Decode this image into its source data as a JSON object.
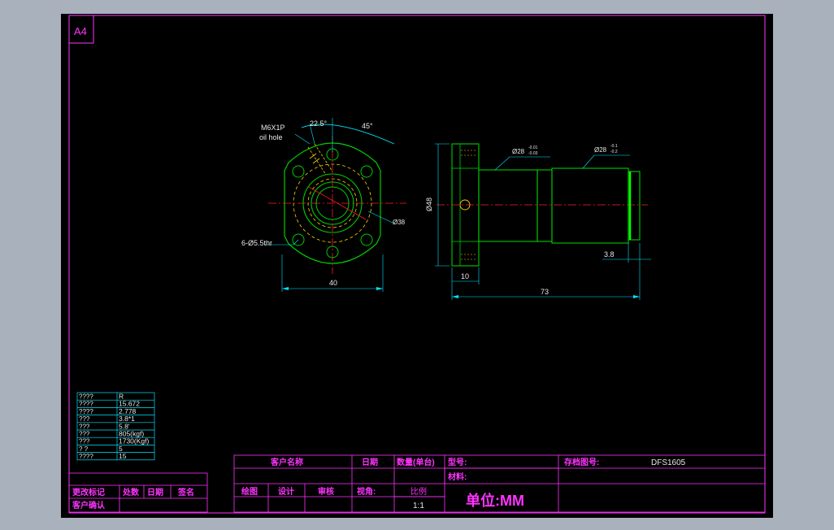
{
  "sheet": {
    "paper_size": "A4",
    "colors": {
      "background": "#000000",
      "border": "#ff33ff",
      "part": "#00cc00",
      "dimension": "#00e5ff",
      "center": "#ff2020",
      "hidden": "#ffd000"
    }
  },
  "drawing": {
    "front_view": {
      "thread_label": "M6X1P",
      "oil_hole_label": "oil hole",
      "angle_a": "22.5°",
      "angle_b": "45°",
      "bolt_holes": "6-Ø5.5thr",
      "pcd": "Ø38",
      "width": "40"
    },
    "side_view": {
      "flange_dia": "Ø48",
      "tol_28a": "Ø28",
      "tol_28a_upper": "-0.01",
      "tol_28a_lower": "-0.03",
      "tol_28b": "Ø28",
      "tol_28b_upper": "-0.1",
      "tol_28b_lower": "-0.2",
      "flange_thk": "10",
      "total_len": "73",
      "end_len": "3.8"
    }
  },
  "spec_table": {
    "rows": [
      {
        "k": "????",
        "v": "R"
      },
      {
        "k": "????",
        "v": "15.672"
      },
      {
        "k": "????",
        "v": "2.778"
      },
      {
        "k": "???",
        "v": "3.8*1"
      },
      {
        "k": "???",
        "v": "5.8'"
      },
      {
        "k": "???",
        "v": "805(kgf)"
      },
      {
        "k": "???",
        "v": "1730(Kgf)"
      },
      {
        "k": "?  ?",
        "v": "5"
      },
      {
        "k": "????",
        "v": "15"
      }
    ]
  },
  "revision_block": {
    "h1": "更改标记",
    "h2": "处数",
    "h3": "日期",
    "h4": "签名",
    "customer_confirm": "客户确认"
  },
  "title_block": {
    "customer_name": "客户名称",
    "date": "日期",
    "quantity": "数量(单台)",
    "model": "型号:",
    "file_no": "存档图号:",
    "file_no_value": "DFS1605",
    "material": "材料:",
    "drawn": "绘图",
    "design": "设计",
    "review": "审核",
    "projection": "视角:",
    "scale": "比例",
    "scale_value": "1:1",
    "unit": "单位:MM"
  }
}
